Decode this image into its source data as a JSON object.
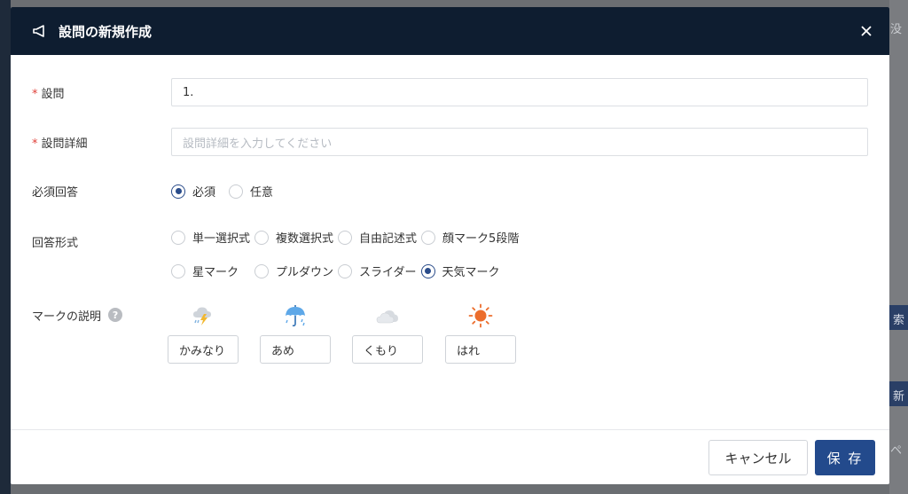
{
  "modal": {
    "title": "設問の新規作成",
    "fields": {
      "question": {
        "label": "設問",
        "required_mark": "*",
        "value": "1."
      },
      "detail": {
        "label": "設問詳細",
        "required_mark": "*",
        "placeholder": "設問詳細を入力してください"
      },
      "required_answer": {
        "label": "必須回答",
        "options": [
          {
            "label": "必須",
            "checked": true
          },
          {
            "label": "任意",
            "checked": false
          }
        ]
      },
      "answer_format": {
        "label": "回答形式",
        "options_row1": [
          {
            "label": "単一選択式",
            "checked": false
          },
          {
            "label": "複数選択式",
            "checked": false
          },
          {
            "label": "自由記述式",
            "checked": false
          },
          {
            "label": "顔マーク5段階",
            "checked": false
          }
        ],
        "options_row2": [
          {
            "label": "星マーク",
            "checked": false
          },
          {
            "label": "プルダウン",
            "checked": false
          },
          {
            "label": "スライダー",
            "checked": false
          },
          {
            "label": "天気マーク",
            "checked": true
          }
        ]
      },
      "mark_description": {
        "label": "マークの説明",
        "help": "?",
        "items": [
          {
            "icon": "thunder-cloud-icon",
            "value": "かみなり"
          },
          {
            "icon": "umbrella-icon",
            "value": "あめ"
          },
          {
            "icon": "cloud-icon",
            "value": "くもり"
          },
          {
            "icon": "sun-icon",
            "value": "はれ"
          }
        ]
      }
    },
    "buttons": {
      "cancel": "キャンセル",
      "save": "保 存"
    }
  },
  "background": {
    "frag_top": "没（",
    "btn_search": "索",
    "btn_new": "新",
    "frag_bottom": "ペ"
  },
  "colors": {
    "header_bg": "#0e1d30",
    "primary": "#234a8c",
    "required": "#e0413a"
  }
}
